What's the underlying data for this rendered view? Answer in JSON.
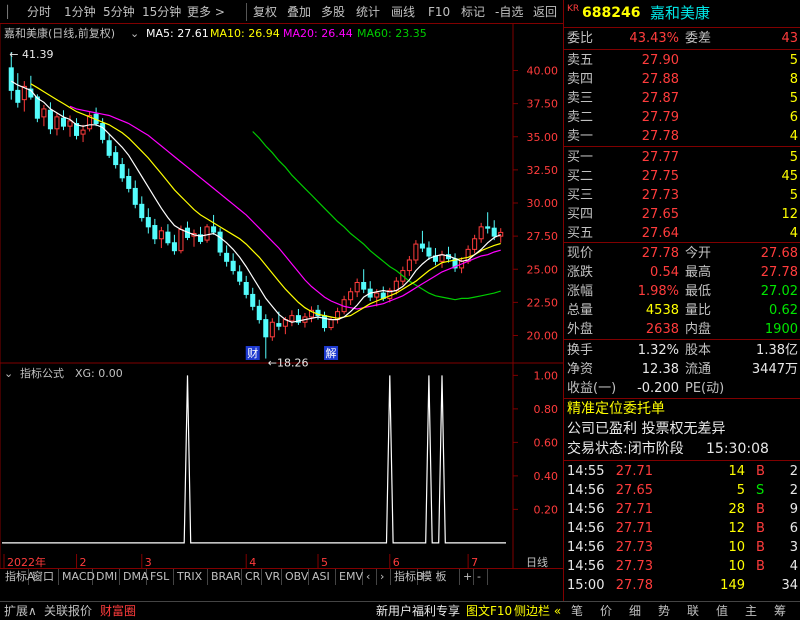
{
  "toolbar": {
    "left": [
      "分时",
      "1分钟",
      "5分钟",
      "15分钟",
      "更多 >"
    ],
    "right": [
      "复权",
      "叠加",
      "多股",
      "统计",
      "画线",
      "F10",
      "标记",
      "-自选",
      "返回"
    ]
  },
  "chart_header": {
    "stock_label": "嘉和美康(日线,前复权)",
    "ma5": "MA5: 27.61",
    "ma10": "MA10: 26.94",
    "ma20": "MA20: 26.44",
    "ma60": "MA60: 23.35",
    "colors": {
      "ma5": "#ffffff",
      "ma10": "#ffff00",
      "ma20": "#ff00ff",
      "ma60": "#00cc00"
    }
  },
  "indicator_header": {
    "name": "指标公式",
    "value": "XG: 0.00"
  },
  "annotations": {
    "high": "41.39",
    "low": "18.26",
    "cai": "财",
    "jie": "解"
  },
  "x_labels": [
    "2022年",
    "2",
    "3",
    "4",
    "5",
    "6",
    "7"
  ],
  "x_axis_right": "日线",
  "chart_data": [
    {
      "type": "line",
      "title": "嘉和美康(日线,前复权)",
      "y_ticks": [
        40.0,
        37.5,
        35.0,
        32.5,
        30.0,
        27.5,
        25.0,
        22.5,
        20.0
      ],
      "ylim": [
        18.0,
        42.0
      ],
      "candles": [
        [
          40.2,
          41.39,
          37.8,
          38.5
        ],
        [
          38.5,
          39.8,
          37.2,
          37.6
        ],
        [
          37.8,
          39.2,
          36.9,
          38.8
        ],
        [
          38.6,
          39.6,
          37.8,
          38.0
        ],
        [
          38.0,
          38.2,
          36.1,
          36.4
        ],
        [
          36.5,
          37.4,
          35.8,
          37.1
        ],
        [
          37.0,
          37.6,
          35.2,
          35.6
        ],
        [
          35.6,
          36.8,
          35.1,
          36.5
        ],
        [
          36.4,
          37.0,
          35.5,
          35.8
        ],
        [
          35.8,
          36.6,
          35.0,
          36.2
        ],
        [
          36.0,
          36.4,
          34.8,
          35.1
        ],
        [
          35.2,
          35.9,
          34.6,
          35.5
        ],
        [
          35.6,
          36.9,
          35.4,
          36.6
        ],
        [
          36.7,
          37.2,
          35.8,
          36.0
        ],
        [
          36.0,
          36.4,
          34.5,
          34.8
        ],
        [
          34.7,
          35.2,
          33.4,
          33.6
        ],
        [
          33.8,
          34.3,
          32.6,
          32.9
        ],
        [
          32.9,
          33.4,
          31.6,
          31.9
        ],
        [
          32.0,
          32.6,
          30.8,
          31.1
        ],
        [
          31.1,
          31.7,
          29.6,
          29.9
        ],
        [
          29.9,
          30.5,
          28.6,
          28.9
        ],
        [
          28.9,
          29.6,
          27.7,
          28.2
        ],
        [
          28.3,
          28.8,
          26.9,
          27.3
        ],
        [
          27.3,
          28.2,
          26.6,
          27.9
        ],
        [
          27.8,
          28.4,
          26.8,
          27.0
        ],
        [
          27.0,
          27.6,
          26.1,
          26.4
        ],
        [
          26.4,
          28.3,
          26.2,
          28.0
        ],
        [
          28.1,
          28.6,
          27.2,
          27.4
        ],
        [
          27.5,
          28.0,
          26.7,
          27.7
        ],
        [
          27.6,
          28.2,
          26.9,
          27.1
        ],
        [
          27.2,
          28.4,
          27.0,
          28.2
        ],
        [
          28.2,
          29.1,
          27.6,
          27.8
        ],
        [
          27.8,
          28.1,
          26.0,
          26.3
        ],
        [
          26.2,
          26.8,
          25.2,
          25.6
        ],
        [
          25.6,
          26.2,
          24.6,
          24.9
        ],
        [
          24.8,
          25.3,
          23.8,
          24.1
        ],
        [
          24.0,
          24.5,
          22.8,
          23.1
        ],
        [
          23.1,
          23.6,
          21.9,
          22.2
        ],
        [
          22.2,
          22.7,
          20.9,
          21.2
        ],
        [
          21.2,
          21.6,
          18.26,
          19.9
        ],
        [
          19.9,
          21.3,
          19.6,
          21.0
        ],
        [
          20.9,
          21.8,
          20.4,
          20.7
        ],
        [
          20.7,
          21.4,
          20.1,
          21.2
        ],
        [
          21.1,
          21.9,
          20.7,
          21.5
        ],
        [
          21.5,
          22.0,
          20.8,
          21.0
        ],
        [
          21.0,
          21.7,
          20.6,
          21.4
        ],
        [
          21.4,
          22.2,
          21.0,
          21.9
        ],
        [
          21.9,
          22.3,
          21.2,
          21.5
        ],
        [
          21.5,
          21.8,
          20.3,
          20.6
        ],
        [
          20.6,
          21.4,
          20.4,
          21.2
        ],
        [
          21.2,
          22.1,
          20.9,
          21.8
        ],
        [
          21.8,
          23.0,
          21.6,
          22.7
        ],
        [
          22.7,
          23.6,
          22.3,
          23.3
        ],
        [
          23.3,
          24.3,
          22.9,
          24.0
        ],
        [
          24.0,
          25.0,
          23.2,
          23.5
        ],
        [
          23.5,
          24.1,
          22.6,
          22.9
        ],
        [
          22.9,
          23.5,
          22.2,
          23.2
        ],
        [
          23.2,
          23.7,
          22.6,
          22.8
        ],
        [
          22.8,
          23.6,
          22.5,
          23.4
        ],
        [
          23.4,
          24.4,
          23.1,
          24.1
        ],
        [
          24.1,
          25.2,
          23.8,
          24.9
        ],
        [
          24.9,
          26.0,
          24.5,
          25.7
        ],
        [
          25.7,
          27.2,
          25.4,
          26.9
        ],
        [
          26.9,
          27.9,
          26.3,
          26.6
        ],
        [
          26.6,
          27.1,
          25.7,
          26.0
        ],
        [
          26.0,
          26.6,
          25.3,
          25.6
        ],
        [
          25.6,
          26.4,
          25.1,
          26.1
        ],
        [
          26.1,
          26.7,
          25.5,
          25.8
        ],
        [
          25.8,
          26.2,
          24.8,
          25.1
        ],
        [
          25.1,
          25.9,
          24.7,
          25.6
        ],
        [
          25.6,
          26.8,
          25.4,
          26.5
        ],
        [
          26.5,
          27.6,
          26.2,
          27.3
        ],
        [
          27.3,
          28.5,
          27.0,
          28.2
        ],
        [
          28.2,
          29.3,
          27.7,
          28.1
        ],
        [
          28.1,
          28.7,
          27.2,
          27.5
        ],
        [
          27.5,
          28.1,
          27.0,
          27.78
        ]
      ],
      "ma5": [
        39.2,
        38.9,
        38.7,
        38.5,
        37.9,
        37.6,
        37.1,
        36.8,
        36.5,
        36.3,
        35.9,
        35.8,
        35.9,
        35.9,
        35.7,
        35.2,
        34.7,
        34.2,
        33.6,
        32.8,
        32.0,
        31.2,
        30.4,
        29.6,
        28.9,
        28.3,
        28.0,
        27.8,
        27.6,
        27.5,
        27.6,
        27.7,
        27.4,
        27.0,
        26.5,
        25.9,
        25.2,
        24.4,
        23.6,
        22.8,
        22.2,
        21.6,
        21.2,
        21.0,
        21.1,
        21.2,
        21.3,
        21.4,
        21.3,
        21.2,
        21.2,
        21.4,
        21.8,
        22.3,
        22.9,
        23.2,
        23.3,
        23.4,
        23.3,
        23.4,
        23.7,
        24.2,
        24.9,
        25.4,
        25.8,
        26.0,
        26.1,
        26.0,
        25.8,
        25.6,
        25.7,
        26.1,
        26.5,
        27.0,
        27.4,
        27.61
      ],
      "ma10": [
        null,
        null,
        null,
        39.0,
        38.7,
        38.4,
        38.1,
        37.8,
        37.5,
        37.2,
        36.9,
        36.7,
        36.5,
        36.3,
        36.1,
        35.9,
        35.6,
        35.3,
        34.9,
        34.4,
        33.9,
        33.4,
        32.8,
        32.2,
        31.6,
        31.0,
        30.5,
        30.0,
        29.5,
        29.1,
        28.8,
        28.5,
        28.2,
        27.9,
        27.6,
        27.3,
        26.9,
        26.4,
        25.9,
        25.3,
        24.7,
        24.1,
        23.5,
        23.0,
        22.5,
        22.1,
        21.8,
        21.6,
        21.5,
        21.4,
        21.3,
        21.4,
        21.5,
        21.8,
        22.1,
        22.4,
        22.6,
        22.8,
        23.0,
        23.2,
        23.5,
        23.8,
        24.1,
        24.5,
        24.9,
        25.2,
        25.5,
        25.6,
        25.7,
        25.8,
        25.9,
        26.1,
        26.4,
        26.6,
        26.8,
        26.94
      ],
      "ma20": [
        null,
        null,
        null,
        null,
        null,
        null,
        null,
        null,
        null,
        37.3,
        37.1,
        37.0,
        36.9,
        36.8,
        36.7,
        36.6,
        36.4,
        36.2,
        36.0,
        35.7,
        35.4,
        35.1,
        34.7,
        34.3,
        33.9,
        33.5,
        33.1,
        32.7,
        32.3,
        31.9,
        31.5,
        31.1,
        30.7,
        30.3,
        29.9,
        29.5,
        29.1,
        28.6,
        28.1,
        27.6,
        27.1,
        26.6,
        26.0,
        25.4,
        24.8,
        24.2,
        23.7,
        23.3,
        22.9,
        22.6,
        22.4,
        22.2,
        22.1,
        22.0,
        22.1,
        22.2,
        22.3,
        22.4,
        22.6,
        22.8,
        23.0,
        23.3,
        23.6,
        23.9,
        24.2,
        24.5,
        24.8,
        25.0,
        25.2,
        25.4,
        25.6,
        25.8,
        26.0,
        26.1,
        26.3,
        26.44
      ],
      "ma60": [
        null,
        null,
        null,
        null,
        null,
        null,
        null,
        null,
        null,
        null,
        null,
        null,
        null,
        null,
        null,
        null,
        null,
        null,
        null,
        null,
        null,
        null,
        null,
        null,
        null,
        null,
        null,
        null,
        null,
        null,
        null,
        null,
        null,
        null,
        null,
        null,
        null,
        35.4,
        34.9,
        34.3,
        33.8,
        33.2,
        32.7,
        32.1,
        31.6,
        31.1,
        30.6,
        30.1,
        29.6,
        29.1,
        28.6,
        28.2,
        27.7,
        27.3,
        26.9,
        26.4,
        26.0,
        25.6,
        25.2,
        24.9,
        24.5,
        24.1,
        23.8,
        23.5,
        23.2,
        23.0,
        22.9,
        22.8,
        22.7,
        22.8,
        22.8,
        22.9,
        23.0,
        23.1,
        23.2,
        23.35
      ]
    },
    {
      "type": "line",
      "title": "指标公式 XG",
      "y_ticks": [
        1.0,
        0.8,
        0.6,
        0.4,
        0.2
      ],
      "ylim": [
        -0.15,
        1.05
      ],
      "spikes": [
        27,
        58,
        64,
        66
      ],
      "values_label": "XG"
    }
  ],
  "stock": {
    "code": "688246",
    "name": "嘉和美康",
    "badge": "KR"
  },
  "weibi": {
    "label1": "委比",
    "value1": "43.43%",
    "label2": "委差",
    "value2": "43"
  },
  "asks": [
    {
      "label": "卖五",
      "price": "27.90",
      "vol": "5"
    },
    {
      "label": "卖四",
      "price": "27.88",
      "vol": "8"
    },
    {
      "label": "卖三",
      "price": "27.87",
      "vol": "5"
    },
    {
      "label": "卖二",
      "price": "27.79",
      "vol": "6"
    },
    {
      "label": "卖一",
      "price": "27.78",
      "vol": "4"
    }
  ],
  "bids": [
    {
      "label": "买一",
      "price": "27.77",
      "vol": "5"
    },
    {
      "label": "买二",
      "price": "27.75",
      "vol": "45"
    },
    {
      "label": "买三",
      "price": "27.73",
      "vol": "5"
    },
    {
      "label": "买四",
      "price": "27.65",
      "vol": "12"
    },
    {
      "label": "买五",
      "price": "27.64",
      "vol": "4"
    }
  ],
  "quote": [
    {
      "l1": "现价",
      "v1": "27.78",
      "c1": "red",
      "l2": "今开",
      "v2": "27.68",
      "c2": "red"
    },
    {
      "l1": "涨跌",
      "v1": "0.54",
      "c1": "red",
      "l2": "最高",
      "v2": "27.78",
      "c2": "red"
    },
    {
      "l1": "涨幅",
      "v1": "1.98%",
      "c1": "red",
      "l2": "最低",
      "v2": "27.02",
      "c2": "green"
    },
    {
      "l1": "总量",
      "v1": "4538",
      "c1": "yellow",
      "l2": "量比",
      "v2": "0.62",
      "c2": "green"
    },
    {
      "l1": "外盘",
      "v1": "2638",
      "c1": "red",
      "l2": "内盘",
      "v2": "1900",
      "c2": "green"
    }
  ],
  "fund": [
    {
      "l1": "换手",
      "v1": "1.32%",
      "l2": "股本",
      "v2": "1.38亿"
    },
    {
      "l1": "净资",
      "v1": "12.38",
      "l2": "流通",
      "v2": "3447万"
    },
    {
      "l1": "收益(一)",
      "v1": "-0.200",
      "l2": "PE(动)",
      "v2": ""
    }
  ],
  "notes": {
    "order": "精准定位委托单",
    "profit": "公司已盈利 投票权无差异",
    "status_label": "交易状态:闭市阶段",
    "status_time": "15:30:08"
  },
  "ticks": [
    {
      "time": "14:55",
      "price": "27.71",
      "vol": "14",
      "side": "B",
      "n": "2"
    },
    {
      "time": "14:56",
      "price": "27.65",
      "vol": "5",
      "side": "S",
      "n": "2"
    },
    {
      "time": "14:56",
      "price": "27.71",
      "vol": "28",
      "side": "B",
      "n": "9"
    },
    {
      "time": "14:56",
      "price": "27.71",
      "vol": "12",
      "side": "B",
      "n": "6"
    },
    {
      "time": "14:56",
      "price": "27.73",
      "vol": "10",
      "side": "B",
      "n": "3"
    },
    {
      "time": "14:56",
      "price": "27.73",
      "vol": "10",
      "side": "B",
      "n": "4"
    },
    {
      "time": "15:00",
      "price": "27.78",
      "vol": "149",
      "side": "",
      "n": "34"
    }
  ],
  "indicator_tabs": [
    "指标A",
    "窗口",
    "MACD",
    "DMI",
    "DMA",
    "FSL",
    "TRIX",
    "BRAR",
    "CR",
    "VR",
    "OBV",
    "ASI",
    "EMV",
    "‹",
    "›",
    "指标B",
    "模 板",
    "+",
    "-"
  ],
  "status_left": [
    {
      "text": "扩展∧",
      "color": "#c0c0c0"
    },
    {
      "text": "关联报价",
      "color": "#c0c0c0"
    },
    {
      "text": "财富圈",
      "color": "#ff3c3c"
    },
    {
      "text": "新用户福利专享",
      "color": "#e8e8e8"
    },
    {
      "text": "图文F10",
      "color": "#ffff00"
    },
    {
      "text": "侧边栏 «",
      "color": "#ffff00"
    }
  ],
  "status_right": [
    "笔",
    "价",
    "细",
    "势",
    "联",
    "值",
    "主",
    "筹"
  ]
}
